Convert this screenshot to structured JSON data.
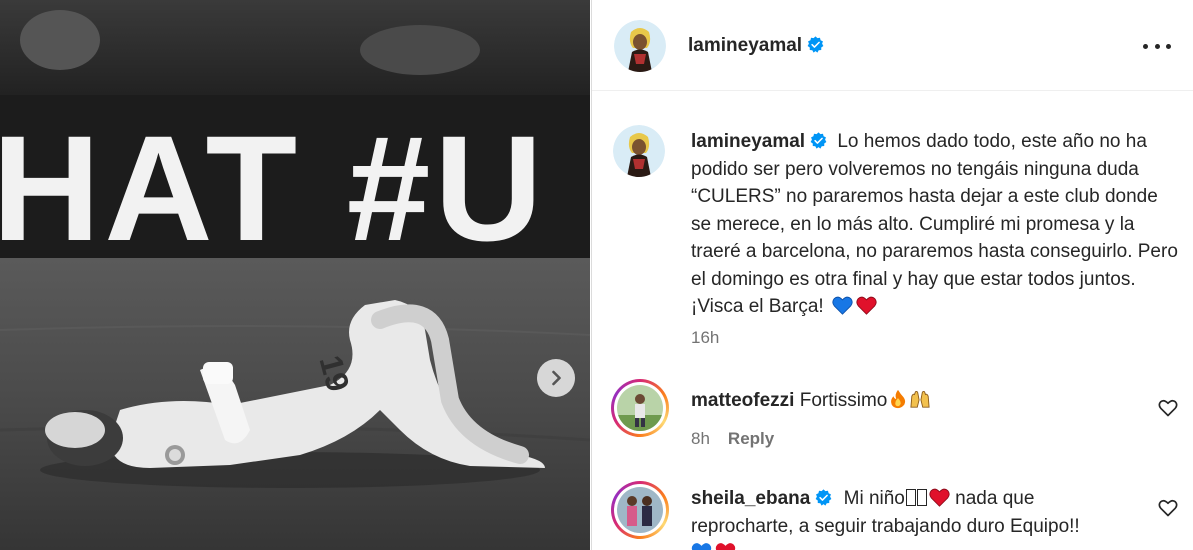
{
  "post": {
    "photo": {
      "banner_text": "HAT #U",
      "jersey_number": "19"
    },
    "carousel_next_icon": "chevron-right-icon"
  },
  "header": {
    "username": "lamineyamal",
    "verified_icon": "verified-badge-icon",
    "more_icon": "more-options-icon"
  },
  "caption": {
    "username": "lamineyamal",
    "text": "Lo hemos dado todo, este año no ha podido ser pero volveremos no tengáis ninguna duda “CULERS” no pararemos hasta dejar a este club donde se merece, en lo más alto. Cumpliré mi promesa y la traeré a barcelona, no pararemos hasta conseguirlo. Pero el domingo es otra final y hay que estar todos juntos. ¡Visca el Barça!",
    "emojis": [
      "blue-heart-icon",
      "red-heart-icon"
    ],
    "time": "16h"
  },
  "comments": [
    {
      "username": "matteofezzi",
      "verified": false,
      "text": "Fortissimo",
      "emojis": [
        "fire-icon",
        "raised-hands-icon"
      ],
      "time": "8h",
      "reply_label": "Reply"
    },
    {
      "username": "sheila_ebana",
      "verified": true,
      "text_before": "Mi niño",
      "text_after": "nada que reprocharte, a seguir trabajando duro Equipo!!",
      "emojis": [
        "red-heart-icon"
      ],
      "trailing_emojis": [
        "blue-heart-icon",
        "red-heart-icon"
      ]
    }
  ],
  "colors": {
    "verified_blue": "#0095f6",
    "secondary_text": "#737373",
    "primary_text": "#262626",
    "heart_red": "#e0112b",
    "heart_blue": "#1877e5"
  }
}
